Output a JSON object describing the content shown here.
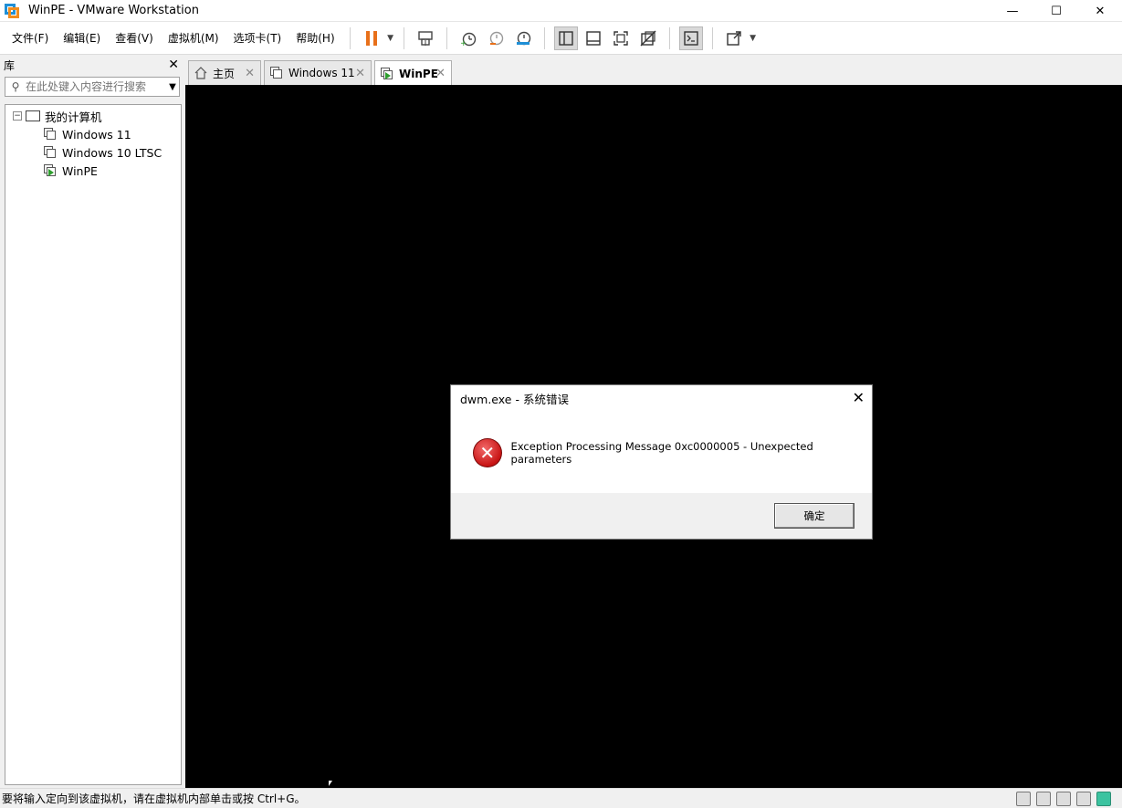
{
  "window": {
    "title": "WinPE - VMware Workstation",
    "minimize": "—",
    "maximize": "☐",
    "close": "✕"
  },
  "menu": [
    "文件(F)",
    "编辑(E)",
    "查看(V)",
    "虚拟机(M)",
    "选项卡(T)",
    "帮助(H)"
  ],
  "toolbar": {
    "icons": [
      "pause-icon",
      "send-ctrl-alt-del-icon",
      "snapshot-icon",
      "revert-snapshot-icon",
      "snapshot-manager-icon",
      "show-library-icon",
      "thumbnail-bar-icon",
      "fullscreen-icon",
      "unity-icon",
      "console-view-icon",
      "stretch-icon"
    ],
    "pause_color": "#e8701a"
  },
  "library": {
    "title": "库",
    "close": "✕",
    "search_placeholder": "在此处键入内容进行搜索",
    "tree": {
      "root": "我的计算机",
      "toggle": "−",
      "items": [
        "Windows 11",
        "Windows 10 LTSC",
        "WinPE"
      ]
    }
  },
  "tabs": [
    {
      "label": "主页",
      "close": "✕",
      "icon": "home-icon"
    },
    {
      "label": "Windows 11",
      "close": "✕",
      "icon": "vm-icon"
    },
    {
      "label": "WinPE",
      "close": "✕",
      "icon": "vm-running-icon",
      "active": true
    }
  ],
  "dialog": {
    "title": "dwm.exe - 系统错误",
    "close": "✕",
    "error_symbol": "✕",
    "message": "Exception Processing Message 0xc0000005 - Unexpected parameters",
    "ok_label": "确定"
  },
  "status": {
    "text": "要将输入定向到该虚拟机，请在虚拟机内部单击或按 Ctrl+G。"
  }
}
